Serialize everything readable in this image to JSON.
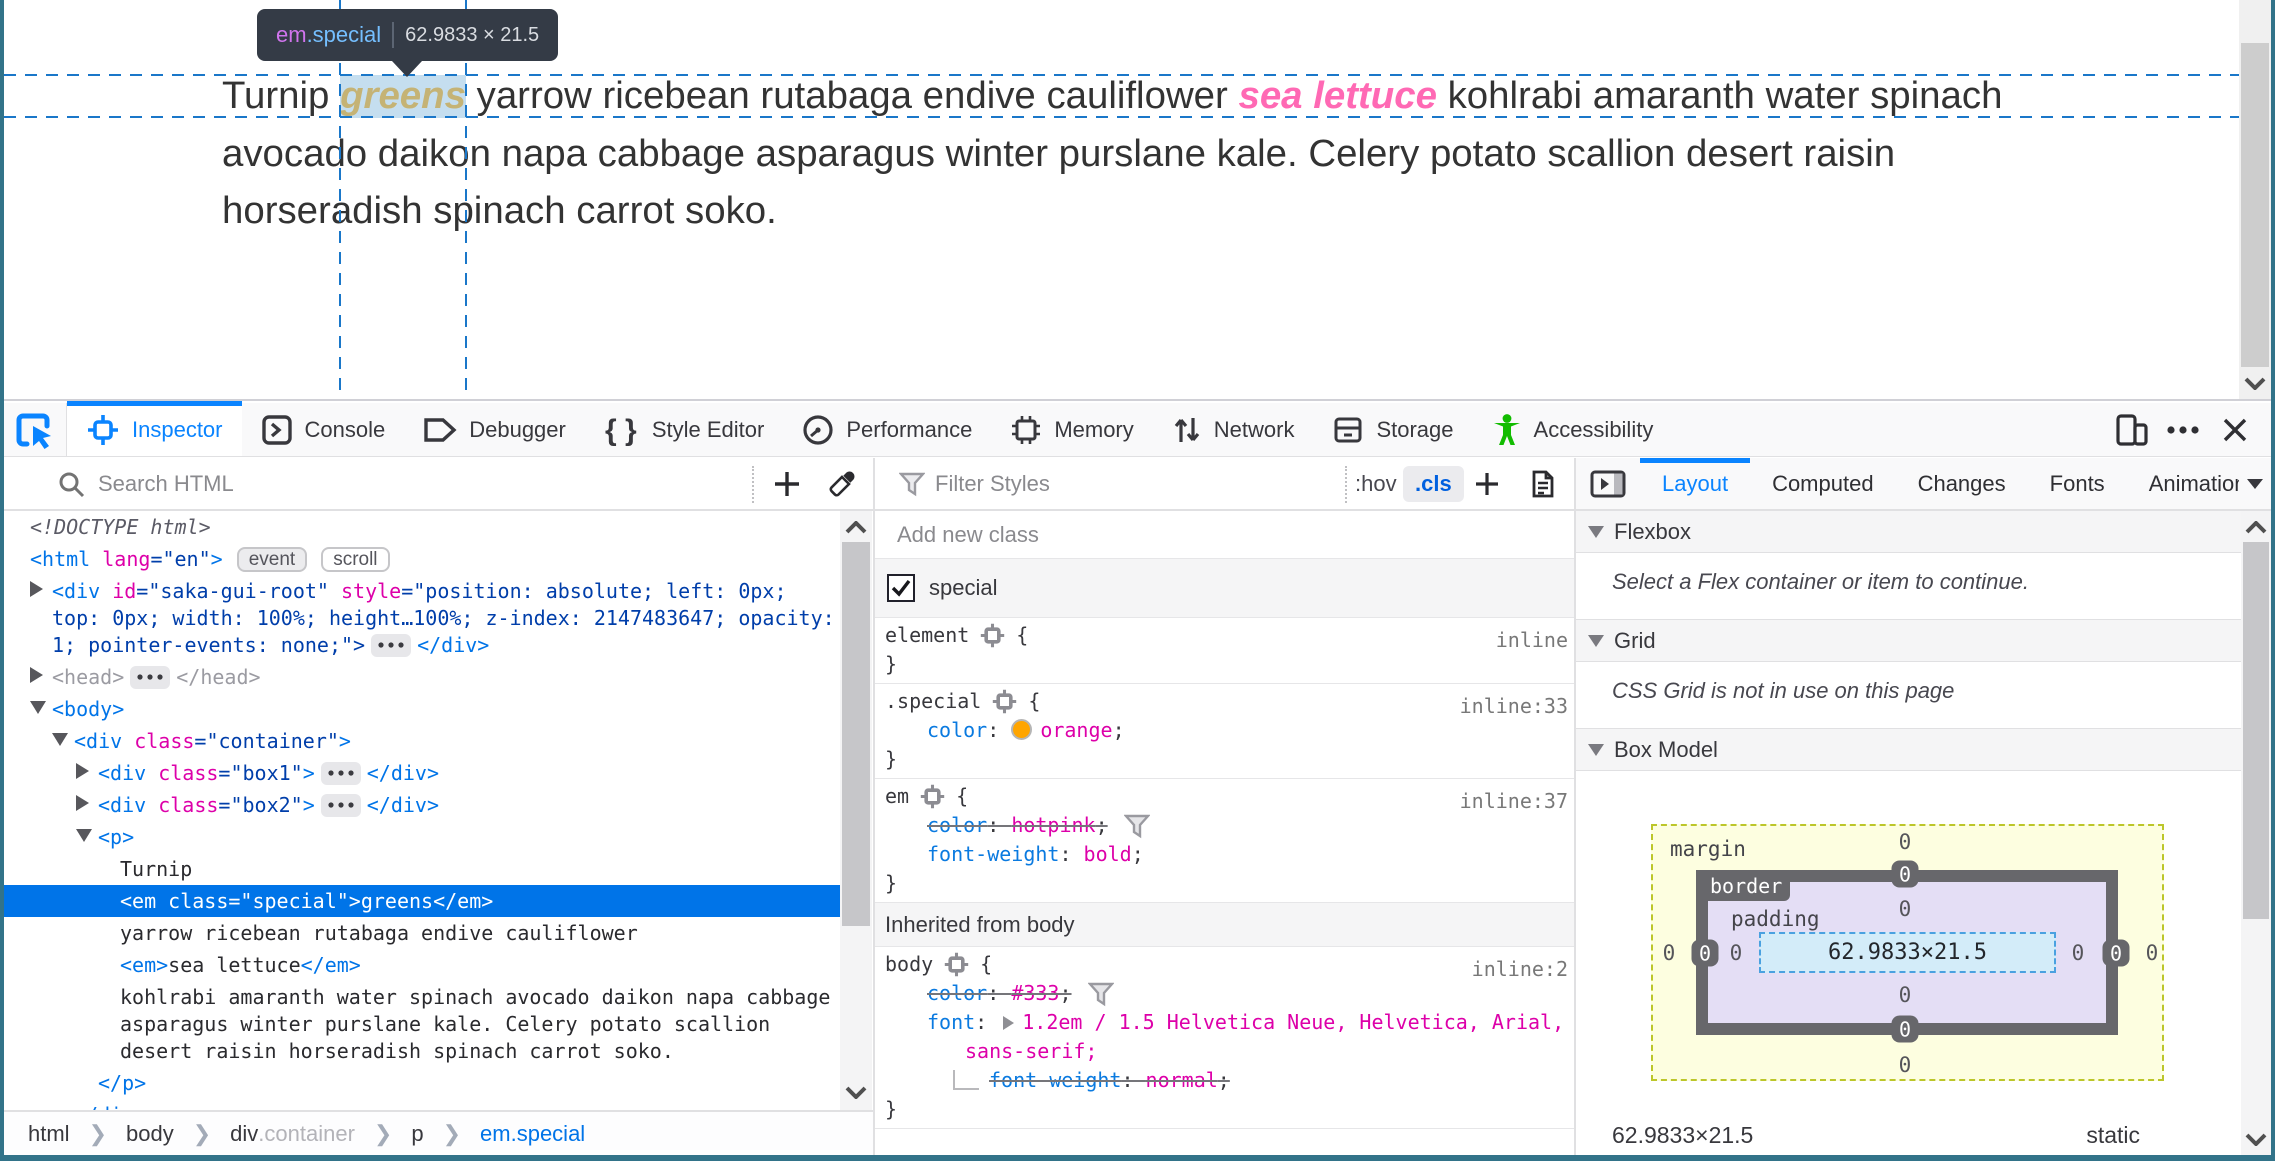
{
  "page": {
    "lines": [
      [
        {
          "t": "Turnip ",
          "s": "plain"
        },
        {
          "t": "greens",
          "s": "em-orange"
        },
        {
          "t": " yarrow ricebean rutabaga endive cauliflower ",
          "s": "plain"
        },
        {
          "t": "sea lettuce",
          "s": "em-pink"
        },
        {
          "t": " kohlrabi amaranth water spinach",
          "s": "plain"
        }
      ],
      [
        {
          "t": "avocado daikon napa cabbage asparagus winter purslane kale. Celery potato scallion desert raisin",
          "s": "plain"
        }
      ],
      [
        {
          "t": "horseradish spinach carrot soko.",
          "s": "plain"
        }
      ]
    ],
    "infobar": {
      "tag": "em",
      "class": ".special",
      "dims": "62.9833 × 21.5"
    }
  },
  "toolbar": {
    "tabs": [
      {
        "label": "Inspector",
        "icon": "inspector",
        "active": true
      },
      {
        "label": "Console",
        "icon": "console",
        "active": false
      },
      {
        "label": "Debugger",
        "icon": "debugger",
        "active": false
      },
      {
        "label": "Style Editor",
        "icon": "style-editor",
        "active": false
      },
      {
        "label": "Performance",
        "icon": "performance",
        "active": false
      },
      {
        "label": "Memory",
        "icon": "memory",
        "active": false
      },
      {
        "label": "Network",
        "icon": "network",
        "active": false
      },
      {
        "label": "Storage",
        "icon": "storage",
        "active": false
      },
      {
        "label": "Accessibility",
        "icon": "accessibility",
        "active": false,
        "icon_color": "#12bc00"
      }
    ],
    "right_buttons": [
      {
        "name": "responsive-design-mode-button",
        "icon": "responsive"
      },
      {
        "name": "meatball-menu-button",
        "icon": "meatball"
      },
      {
        "name": "close-devtools-button",
        "icon": "close"
      }
    ]
  },
  "markup_toolbar": {
    "search_placeholder": "Search HTML"
  },
  "rules_toolbar": {
    "filter_placeholder": "Filter Styles",
    "hov_label": ":hov",
    "cls_label": ".cls"
  },
  "sidebar_tabs": [
    {
      "label": "Layout",
      "active": true
    },
    {
      "label": "Computed",
      "active": false
    },
    {
      "label": "Changes",
      "active": false
    },
    {
      "label": "Fonts",
      "active": false
    },
    {
      "label": "Animations",
      "active": false,
      "clipped": true
    }
  ],
  "markup_rows": [
    {
      "indent": 26,
      "lines": [
        [
          {
            "t": "<!DOCTYPE html>",
            "c": "doctype"
          }
        ]
      ]
    },
    {
      "indent": 26,
      "lines": [
        [
          {
            "t": "<html",
            "c": "tag"
          },
          {
            "t": " lang",
            "c": "attr"
          },
          {
            "t": "=\"en\"",
            "c": "val"
          },
          {
            "t": ">",
            "c": "tag"
          },
          {
            "t": "event",
            "c": "badge"
          },
          {
            "t": "scroll",
            "c": "badge light"
          }
        ]
      ]
    },
    {
      "indent": 48,
      "twisty": "closed",
      "lines": [
        [
          {
            "t": "<div",
            "c": "tag"
          },
          {
            "t": " id",
            "c": "attr"
          },
          {
            "t": "=\"saka-gui-root\"",
            "c": "val"
          },
          {
            "t": " style",
            "c": "attr"
          },
          {
            "t": "=\"position: absolute; left: 0px;",
            "c": "val"
          }
        ],
        [
          {
            "t": "top: 0px; width: 100%; height…100%; z-index: 2147483647; opacity:",
            "c": "val"
          }
        ],
        [
          {
            "t": "1; pointer-events: none;\">",
            "c": "val"
          },
          {
            "t": "⋯",
            "c": "dots"
          },
          {
            "t": "</div>",
            "c": "tag"
          }
        ]
      ]
    },
    {
      "indent": 48,
      "twisty": "closed",
      "faded": true,
      "lines": [
        [
          {
            "t": "<head>",
            "c": "tag"
          },
          {
            "t": "⋯",
            "c": "dots"
          },
          {
            "t": "</head>",
            "c": "tag"
          }
        ]
      ]
    },
    {
      "indent": 48,
      "twisty": "open",
      "lines": [
        [
          {
            "t": "<body>",
            "c": "tag"
          }
        ]
      ]
    },
    {
      "indent": 70,
      "twisty": "open",
      "lines": [
        [
          {
            "t": "<div",
            "c": "tag"
          },
          {
            "t": " class",
            "c": "attr"
          },
          {
            "t": "=\"container\"",
            "c": "val"
          },
          {
            "t": ">",
            "c": "tag"
          }
        ]
      ]
    },
    {
      "indent": 94,
      "twisty": "closed",
      "lines": [
        [
          {
            "t": "<div",
            "c": "tag"
          },
          {
            "t": " class",
            "c": "attr"
          },
          {
            "t": "=\"box1\"",
            "c": "val"
          },
          {
            "t": ">",
            "c": "tag"
          },
          {
            "t": "⋯",
            "c": "dots"
          },
          {
            "t": "</div>",
            "c": "tag"
          }
        ]
      ]
    },
    {
      "indent": 94,
      "twisty": "closed",
      "lines": [
        [
          {
            "t": "<div",
            "c": "tag"
          },
          {
            "t": " class",
            "c": "attr"
          },
          {
            "t": "=\"box2\"",
            "c": "val"
          },
          {
            "t": ">",
            "c": "tag"
          },
          {
            "t": "⋯",
            "c": "dots"
          },
          {
            "t": "</div>",
            "c": "tag"
          }
        ]
      ]
    },
    {
      "indent": 94,
      "twisty": "open",
      "lines": [
        [
          {
            "t": "<p>",
            "c": "tag"
          }
        ]
      ]
    },
    {
      "indent": 116,
      "lines": [
        [
          {
            "t": "Turnip",
            "c": "text"
          }
        ]
      ]
    },
    {
      "indent": 116,
      "selected": true,
      "lines": [
        [
          {
            "t": "<em",
            "c": "tag"
          },
          {
            "t": " class",
            "c": "attr"
          },
          {
            "t": "=\"special\"",
            "c": "val"
          },
          {
            "t": ">",
            "c": "tag"
          },
          {
            "t": "greens",
            "c": "text"
          },
          {
            "t": "</em>",
            "c": "tag"
          }
        ]
      ]
    },
    {
      "indent": 116,
      "lines": [
        [
          {
            "t": "yarrow ricebean rutabaga endive cauliflower",
            "c": "text"
          }
        ]
      ]
    },
    {
      "indent": 116,
      "lines": [
        [
          {
            "t": "<em>",
            "c": "tag"
          },
          {
            "t": "sea lettuce",
            "c": "text"
          },
          {
            "t": "</em>",
            "c": "tag"
          }
        ]
      ]
    },
    {
      "indent": 116,
      "lines": [
        [
          {
            "t": "kohlrabi amaranth water spinach avocado daikon napa cabbage",
            "c": "text"
          }
        ],
        [
          {
            "t": "asparagus winter purslane kale. Celery potato scallion",
            "c": "text"
          }
        ],
        [
          {
            "t": "desert raisin horseradish spinach carrot soko.",
            "c": "text"
          }
        ]
      ]
    },
    {
      "indent": 94,
      "lines": [
        [
          {
            "t": "</p>",
            "c": "tag"
          }
        ]
      ]
    },
    {
      "indent": 70,
      "lines": [
        [
          {
            "t": "</div>",
            "c": "tag"
          }
        ]
      ]
    }
  ],
  "rules": {
    "add_class_placeholder": "Add new class",
    "class_toggle": {
      "checked": true,
      "label": "special"
    },
    "rule_blocks": [
      {
        "selector": "element",
        "location": "inline",
        "declarations": []
      },
      {
        "selector": ".special",
        "location": "inline:33",
        "declarations": [
          {
            "name": "color",
            "value": "orange",
            "swatch": "orange",
            "overridden": false
          }
        ]
      },
      {
        "selector": "em",
        "location": "inline:37",
        "declarations": [
          {
            "name": "color",
            "value": "hotpink",
            "overridden": true
          },
          {
            "name": "font-weight",
            "value": "bold",
            "overridden": false
          }
        ]
      }
    ],
    "inherited_header": "Inherited from body",
    "inherited_blocks": [
      {
        "selector": "body",
        "location": "inline:2",
        "declarations": [
          {
            "name": "color",
            "value": "#333",
            "overridden": true
          },
          {
            "name": "font",
            "value": "1.2em / 1.5 Helvetica Neue, Helvetica, Arial,",
            "value2": "sans-serif;",
            "expander": true,
            "overridden": false
          },
          {
            "name": "font-weight",
            "value": "normal",
            "overridden": true,
            "computed_child": true
          }
        ]
      }
    ]
  },
  "layout_panel": {
    "sections": [
      {
        "title": "Flexbox",
        "message": "Select a Flex container or item to continue."
      },
      {
        "title": "Grid",
        "message": "CSS Grid is not in use on this page"
      },
      {
        "title": "Box Model",
        "message": ""
      }
    ],
    "box_model": {
      "margin_label": "margin",
      "border_label": "border",
      "padding_label": "padding",
      "content_dims": "62.9833×21.5",
      "margin": {
        "top": "0",
        "right": "0",
        "bottom": "0",
        "left": "0"
      },
      "border": {
        "top": "0",
        "right": "0",
        "bottom": "0",
        "left": "0"
      },
      "padding": {
        "top": "0",
        "right": "0",
        "bottom": "0",
        "left": "0"
      },
      "dims_summary": "62.9833×21.5",
      "position": "static"
    }
  },
  "breadcrumbs": [
    {
      "tag": "html",
      "suffix": "",
      "selected": false
    },
    {
      "tag": "body",
      "suffix": "",
      "selected": false
    },
    {
      "tag": "div",
      "suffix": ".container",
      "selected": false
    },
    {
      "tag": "p",
      "suffix": "",
      "selected": false
    },
    {
      "tag": "em.special",
      "suffix": "",
      "selected": true
    }
  ]
}
